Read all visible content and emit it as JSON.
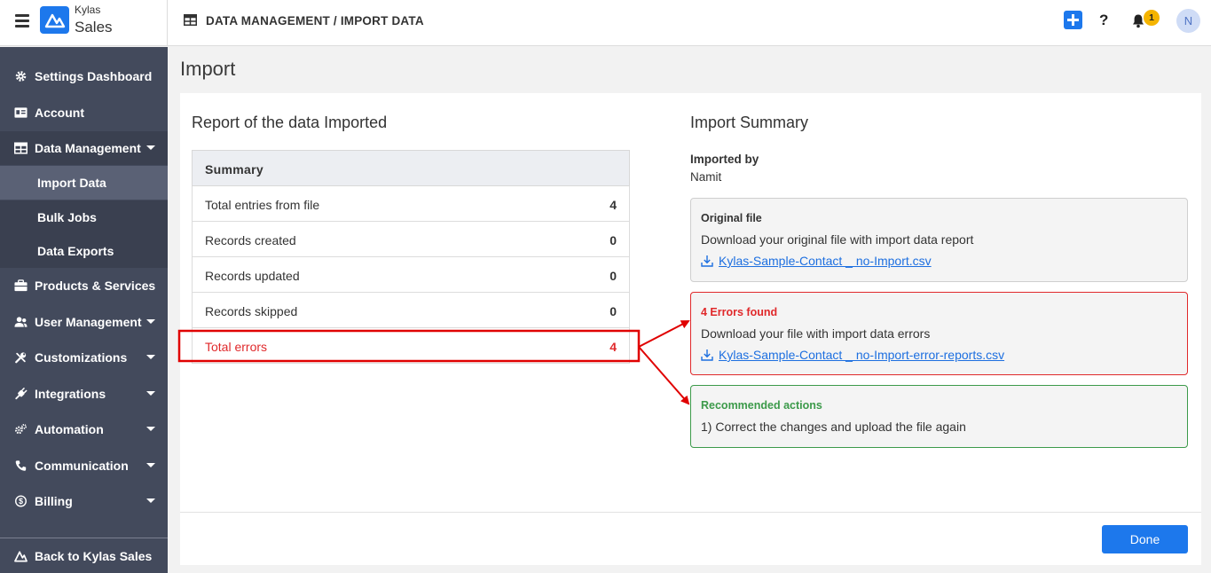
{
  "app": {
    "brand_top": "Kylas",
    "brand_main": "Sales"
  },
  "header": {
    "breadcrumb": "DATA MANAGEMENT / IMPORT DATA",
    "help_label": "?",
    "notification_count": "1",
    "avatar_initial": "N",
    "accent_color": "#1d78ec"
  },
  "sidebar": {
    "items": [
      {
        "label": "Settings Dashboard",
        "icon": "gear-icon"
      },
      {
        "label": "Account",
        "icon": "id-card-icon"
      },
      {
        "label": "Data Management",
        "icon": "table-icon",
        "expanded": true
      },
      {
        "label": "Products & Services",
        "icon": "box-icon"
      },
      {
        "label": "User Management",
        "icon": "users-icon"
      },
      {
        "label": "Customizations",
        "icon": "tools-icon"
      },
      {
        "label": "Integrations",
        "icon": "plug-icon"
      },
      {
        "label": "Automation",
        "icon": "cogs-icon"
      },
      {
        "label": "Communication",
        "icon": "phone-icon"
      },
      {
        "label": "Billing",
        "icon": "dollar-icon"
      }
    ],
    "sub_items": [
      {
        "label": "Import Data",
        "active": true
      },
      {
        "label": "Bulk Jobs"
      },
      {
        "label": "Data Exports"
      }
    ],
    "footer": "Back to Kylas Sales"
  },
  "page": {
    "title": "Import"
  },
  "report": {
    "title": "Report of the data Imported",
    "summary_header": "Summary",
    "rows": [
      {
        "label": "Total entries from file",
        "value": "4"
      },
      {
        "label": "Records created",
        "value": "0"
      },
      {
        "label": "Records updated",
        "value": "0"
      },
      {
        "label": "Records skipped",
        "value": "0"
      },
      {
        "label": "Total errors",
        "value": "4"
      }
    ]
  },
  "import_summary": {
    "title": "Import Summary",
    "imported_by_label": "Imported by",
    "imported_by": "Namit",
    "original": {
      "heading": "Original file",
      "text": "Download your original file with import data report",
      "link": "Kylas-Sample-Contact _ no-Import.csv"
    },
    "errors": {
      "heading": "4 Errors found",
      "text": "Download your file with import data errors",
      "link": "Kylas-Sample-Contact _ no-Import-error-reports.csv",
      "color": "#e0292b"
    },
    "recommended": {
      "heading": "Recommended actions",
      "text": "1) Correct the changes and upload the file again",
      "color": "#3c9a4a"
    }
  },
  "footer": {
    "done_label": "Done"
  }
}
